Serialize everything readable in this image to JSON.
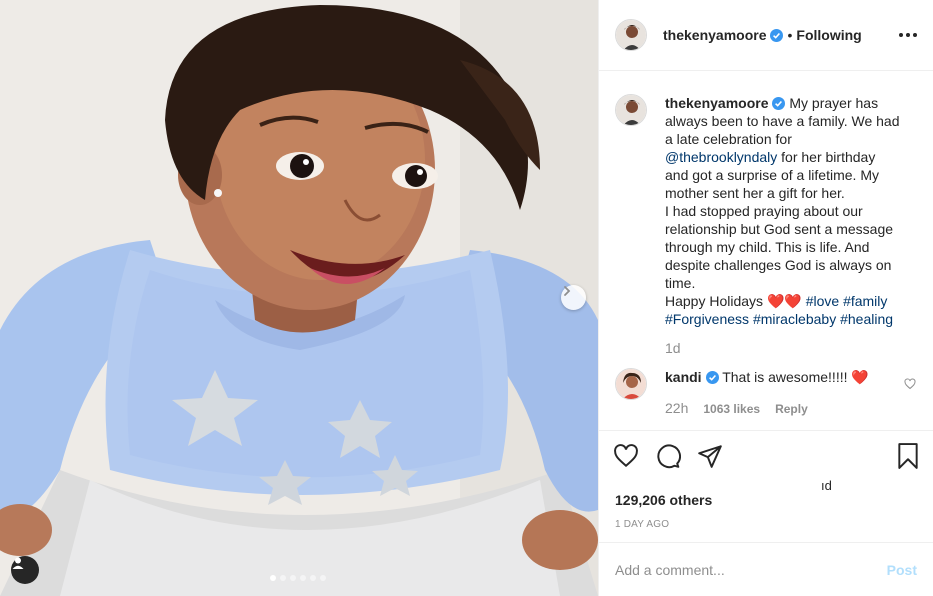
{
  "post": {
    "author": "thekenyamoore",
    "following_label": "Following",
    "separator": "•",
    "verified": true
  },
  "caption": {
    "author": "thekenyamoore",
    "lines": [
      "My prayer has",
      "always been to have a family. We had",
      "a late celebration for",
      "@thebrooklyndaly",
      " for her birthday",
      "and got a surprise of a lifetime. My",
      "mother sent her a gift for her.",
      "I had stopped praying about our",
      "relationship but God sent a message",
      "through my child. This is life. And",
      "despite challenges God is always on",
      "time.",
      "Happy Holidays ",
      "❤️❤️ ",
      "#love",
      "#family",
      "#Forgiveness",
      "#miraclebaby",
      "#healing"
    ],
    "time": "1d"
  },
  "reply": {
    "author": "kandi",
    "text": "That is awesome!!!!!",
    "emoji": "❤️",
    "time": "22h",
    "likes": "1063 likes",
    "reply_label": "Reply"
  },
  "engagement": {
    "likes_text": "129,206 others",
    "liked_stub": "ıd",
    "date": "1 DAY AGO"
  },
  "composer": {
    "placeholder": "Add a comment...",
    "post_label": "Post"
  },
  "carousel": {
    "slides": 6,
    "active": 0
  },
  "colors": {
    "verified": "#3897f0",
    "link": "#00376b",
    "heart": "#ed4956",
    "post_disabled": "#b2dffc"
  },
  "icons": [
    "verified-badge-icon",
    "more-options-icon",
    "heart-icon",
    "comment-icon",
    "share-icon",
    "bookmark-icon",
    "chevron-right-icon",
    "user-tag-icon"
  ]
}
